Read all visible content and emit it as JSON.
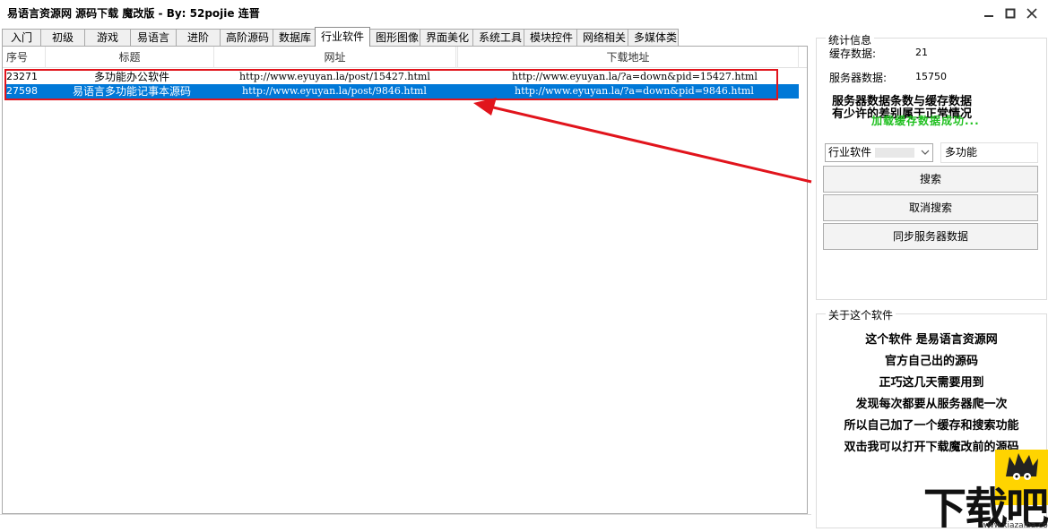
{
  "window": {
    "title": "易语言资源网 源码下载 魔改版 - By: 52pojie 连晋",
    "minimize_symbol": "▁",
    "maximize_symbol": "☐",
    "close_symbol": "✕"
  },
  "tabs": [
    "入门",
    "初级",
    "游戏",
    "易语言",
    "进阶",
    "高阶源码",
    "数据库",
    "行业软件",
    "图形图像",
    "界面美化",
    "系统工具",
    "模块控件",
    "网络相关",
    "多媒体类"
  ],
  "active_tab": "行业软件",
  "list": {
    "columns": [
      "序号",
      "标题",
      "网址",
      "",
      "下载地址"
    ],
    "rows": [
      {
        "id": "23271",
        "title": "多功能办公软件",
        "url": "http://www.eyuyan.la/post/15427.html",
        "download": "http://www.eyuyan.la/?a=down&pid=15427.html",
        "selected": false
      },
      {
        "id": "27598",
        "title": "易语言多功能记事本源码",
        "url": "http://www.eyuyan.la/post/9846.html",
        "download": "http://www.eyuyan.la/?a=down&pid=9846.html",
        "selected": true
      }
    ]
  },
  "stats": {
    "group_title": "统计信息",
    "cache_label": "缓存数据:",
    "cache_value": "21",
    "server_label": "服务器数据:",
    "server_value": "15750",
    "note_line1": "服务器数据条数与缓存数据",
    "note_line2": "有少许的差别属于正常情况",
    "load_status": "加载缓存数据成功...",
    "load_status_color": "#20c020"
  },
  "search": {
    "category": "行业软件",
    "keyword": "多功能",
    "search_button": "搜索",
    "cancel_button": "取消搜索",
    "sync_button": "同步服务器数据"
  },
  "about": {
    "group_title": "关于这个软件",
    "lines": [
      "这个软件 是易语言资源网",
      "官方自己出的源码",
      "正巧这几天需要用到",
      "发现每次都要从服务器爬一次",
      "所以自己加了一个缓存和搜索功能",
      "双击我可以打开下载魔改前的源码"
    ]
  },
  "watermark": {
    "logo_text": "下载吧",
    "url": "www.xiazaiba.com"
  },
  "colors": {
    "selection": "#0078d7",
    "annotation_red": "#e1141c"
  }
}
